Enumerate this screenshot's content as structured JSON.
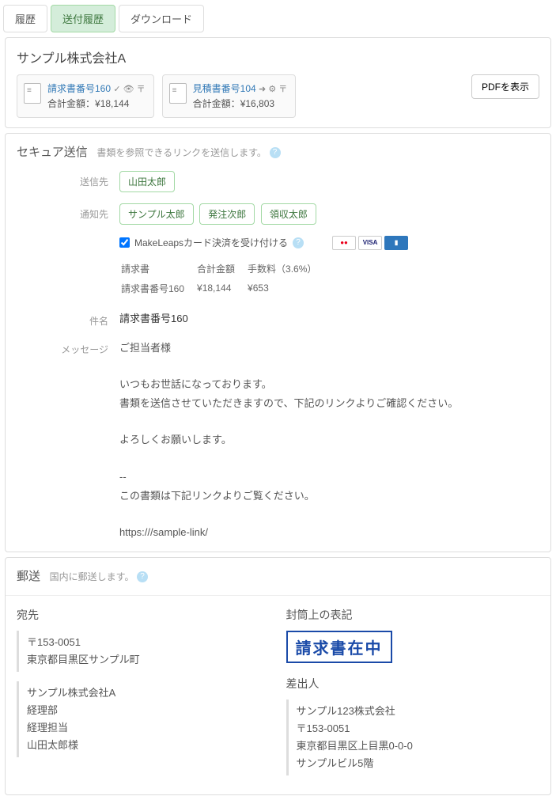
{
  "tabs": {
    "history": "履歴",
    "send_history": "送付履歴",
    "download": "ダウンロード"
  },
  "company": "サンプル株式会社A",
  "docs": [
    {
      "title": "請求書番号160",
      "icons": "✓ 👁 〒",
      "total_label": "合計金額：",
      "total": "¥18,144"
    },
    {
      "title": "見積書番号104",
      "icons": "➜ ⚙ 〒",
      "total_label": "合計金額：",
      "total": "¥16,803"
    }
  ],
  "pdf_btn": "PDFを表示",
  "secure": {
    "title": "セキュア送信",
    "sub": "書類を参照できるリンクを送信します。",
    "to_label": "送信先",
    "to": [
      "山田太郎"
    ],
    "cc_label": "通知先",
    "cc": [
      "サンプル太郎",
      "発注次郎",
      "領収太郎"
    ],
    "card_check": "MakeLeapsカード決済を受け付ける",
    "fee": {
      "h1": "請求書",
      "h2": "合計金額",
      "h3": "手数料（3.6%）",
      "r1": "請求書番号160",
      "r2": "¥18,144",
      "r3": "¥653"
    },
    "subject_label": "件名",
    "subject": "請求書番号160",
    "message_label": "メッセージ",
    "message": "ご担当者様\n\nいつもお世話になっております。\n書類を送信させていただきますので、下記のリンクよりご確認ください。\n\nよろしくお願いします。\n\n--\nこの書類は下記リンクよりご覧ください。\n\nhttps:///sample-link/"
  },
  "postal": {
    "title": "郵送",
    "sub": "国内に郵送します。",
    "dest_h": "宛先",
    "dest": "〒153-0051\n東京都目黒区サンプル町",
    "dest2": "サンプル株式会社A\n経理部\n経理担当\n山田太郎様",
    "env_h": "封筒上の表記",
    "stamp": "請求書在中",
    "sender_h": "差出人",
    "sender": "サンプル123株式会社\n〒153-0051\n東京都目黒区上目黒0-0-0\nサンプルビル5階"
  }
}
